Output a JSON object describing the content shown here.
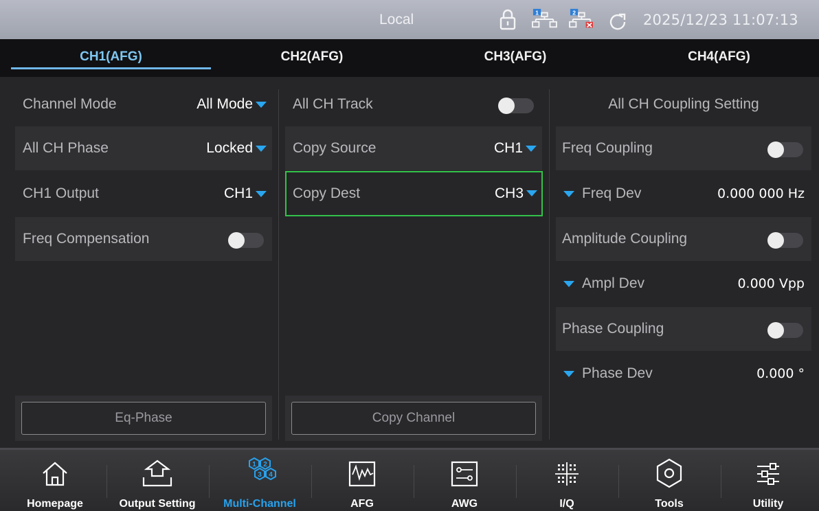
{
  "status_bar": {
    "mode": "Local",
    "datetime": "2025/12/23 11:07:13",
    "lan1_badge": "1",
    "lan2_badge": "2",
    "icons": [
      "lock-icon",
      "network-1-icon",
      "network-2-disconnected-icon",
      "refresh-icon"
    ]
  },
  "tabs": [
    {
      "label": "CH1(AFG)",
      "active": true
    },
    {
      "label": "CH2(AFG)",
      "active": false
    },
    {
      "label": "CH3(AFG)",
      "active": false
    },
    {
      "label": "CH4(AFG)",
      "active": false
    }
  ],
  "left_panel": {
    "channel_mode": {
      "label": "Channel Mode",
      "value": "All Mode"
    },
    "all_ch_phase": {
      "label": "All CH Phase",
      "value": "Locked"
    },
    "ch1_output": {
      "label": "CH1 Output",
      "value": "CH1"
    },
    "freq_compensation": {
      "label": "Freq Compensation",
      "on": false
    },
    "eq_phase_button": "Eq-Phase"
  },
  "middle_panel": {
    "all_ch_track": {
      "label": "All CH Track",
      "on": false
    },
    "copy_source": {
      "label": "Copy Source",
      "value": "CH1"
    },
    "copy_dest": {
      "label": "Copy Dest",
      "value": "CH3"
    },
    "copy_channel_button": "Copy Channel"
  },
  "right_panel": {
    "title": "All CH Coupling Setting",
    "freq_coupling": {
      "label": "Freq Coupling",
      "on": false
    },
    "freq_dev": {
      "label": "Freq Dev",
      "value": "0.000 000 Hz"
    },
    "amplitude_coupling": {
      "label": "Amplitude Coupling",
      "on": false
    },
    "ampl_dev": {
      "label": "Ampl Dev",
      "value": "0.000 Vpp"
    },
    "phase_coupling": {
      "label": "Phase Coupling",
      "on": false
    },
    "phase_dev": {
      "label": "Phase Dev",
      "value": "0.000 °"
    }
  },
  "bottom_nav": [
    {
      "label": "Homepage",
      "icon": "home-icon",
      "active": false
    },
    {
      "label": "Output Setting",
      "icon": "output-setting-icon",
      "active": false
    },
    {
      "label": "Multi-Channel",
      "icon": "multi-channel-icon",
      "active": true
    },
    {
      "label": "AFG",
      "icon": "afg-waveform-icon",
      "active": false
    },
    {
      "label": "AWG",
      "icon": "awg-icon",
      "active": false
    },
    {
      "label": "I/Q",
      "icon": "iq-constellation-icon",
      "active": false
    },
    {
      "label": "Tools",
      "icon": "tools-hexagon-icon",
      "active": false
    },
    {
      "label": "Utility",
      "icon": "utility-sliders-icon",
      "active": false
    }
  ],
  "multi_channel_icon_digits": [
    "1",
    "2",
    "3",
    "4"
  ],
  "colors": {
    "accent_blue": "#2aa6f0",
    "tab_active": "#7ec7f2",
    "selection_green": "#33c24a"
  }
}
